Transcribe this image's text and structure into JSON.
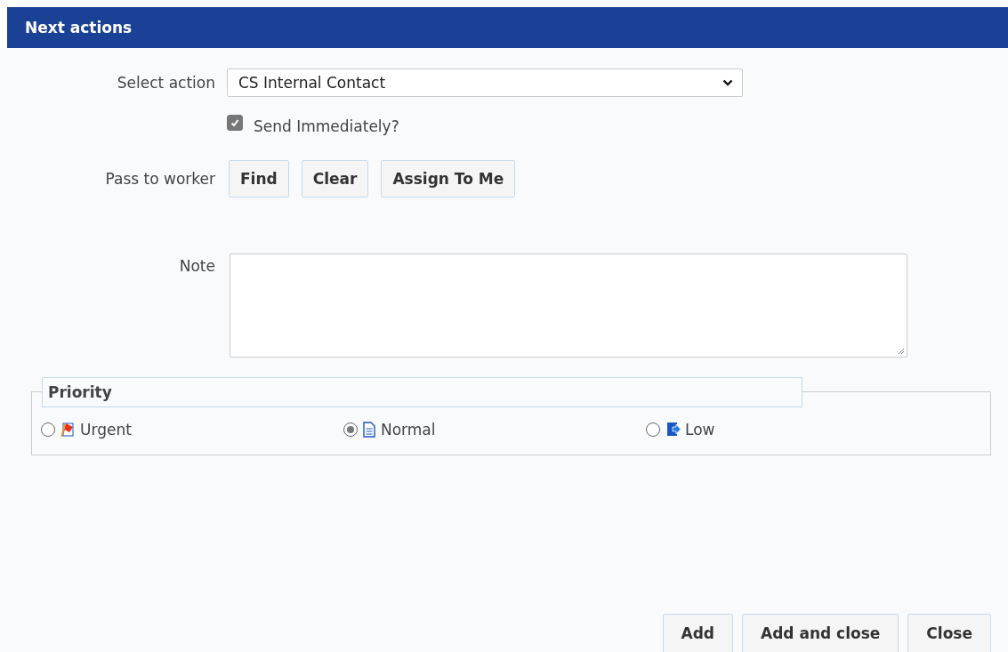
{
  "header": {
    "title": "Next actions"
  },
  "action": {
    "label": "Select action",
    "value": "CS Internal Contact"
  },
  "send_immediately": {
    "label": "Send Immediately?",
    "checked": true
  },
  "worker": {
    "label": "Pass to worker",
    "buttons": [
      "Find",
      "Clear",
      "Assign To Me"
    ]
  },
  "note": {
    "label": "Note"
  },
  "priority": {
    "legend": "Priority",
    "options": [
      {
        "label": "Urgent",
        "kind": "urgent",
        "selected": false
      },
      {
        "label": "Normal",
        "kind": "normal",
        "selected": true
      },
      {
        "label": "Low",
        "kind": "low",
        "selected": false
      }
    ]
  },
  "footer_buttons": [
    "Add",
    "Add and close",
    "Close"
  ]
}
